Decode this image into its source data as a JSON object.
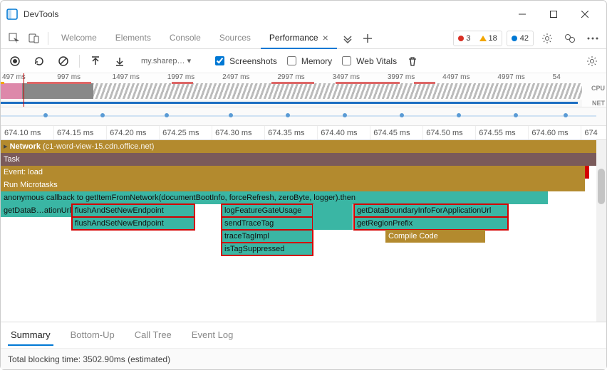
{
  "window": {
    "title": "DevTools"
  },
  "tabs": {
    "items": [
      "Welcome",
      "Elements",
      "Console",
      "Sources",
      "Performance"
    ],
    "active": "Performance",
    "errors": "3",
    "warnings": "18",
    "info": "42"
  },
  "perf_toolbar": {
    "url_hint": "my.sharep… ▾",
    "screenshots_label": "Screenshots",
    "memory_label": "Memory",
    "webvitals_label": "Web Vitals",
    "screenshots_checked": true,
    "memory_checked": false,
    "webvitals_checked": false
  },
  "overview": {
    "ticks": [
      "497 ms",
      "997 ms",
      "1497 ms",
      "1997 ms",
      "2497 ms",
      "2997 ms",
      "3497 ms",
      "3997 ms",
      "4497 ms",
      "4997 ms",
      "54"
    ],
    "cpu_label": "CPU",
    "net_label": "NET"
  },
  "ruler": {
    "ticks": [
      "674.10 ms",
      "674.15 ms",
      "674.20 ms",
      "674.25 ms",
      "674.30 ms",
      "674.35 ms",
      "674.40 ms",
      "674.45 ms",
      "674.50 ms",
      "674.55 ms",
      "674.60 ms",
      "674"
    ]
  },
  "flame": {
    "network_label": "Network",
    "network_detail": "(c1-word-view-15.cdn.office.net)",
    "rows": {
      "task": "Task",
      "event_load": "Event: load",
      "run_microtasks": "Run Microtasks",
      "anon": "anonymous callback to getItemFromNetwork(documentBootInfo, forceRefresh, zeroByte, logger).then",
      "getDataB": "getDataB…ationUrl",
      "flush1": "flushAndSetNewEndpoint",
      "flush2": "flushAndSetNewEndpoint",
      "logFG": "logFeatureGateUsage",
      "sendTrace": "sendTraceTag",
      "traceImpl": "traceTagImpl",
      "isTag": "isTagSuppressed",
      "getDataBoundary": "getDataBoundaryInfoForApplicationUrl",
      "getRegion": "getRegionPrefix",
      "compile": "Compile Code"
    }
  },
  "bottom_tabs": [
    "Summary",
    "Bottom-Up",
    "Call Tree",
    "Event Log"
  ],
  "status": "Total blocking time: 3502.90ms (estimated)"
}
